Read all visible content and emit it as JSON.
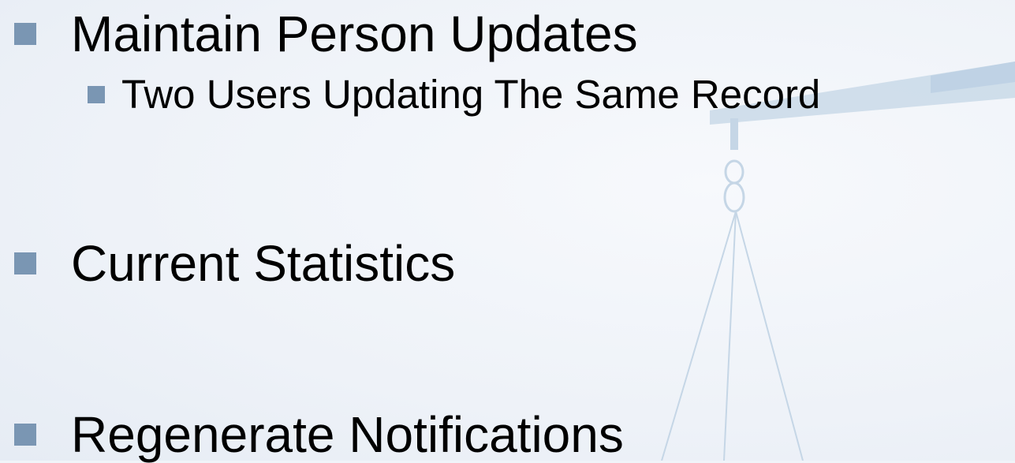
{
  "slide": {
    "bullets": [
      {
        "text": "Maintain Person Updates",
        "sub_bullets": [
          {
            "text": "Two Users Updating The Same Record"
          }
        ]
      },
      {
        "text": "Current Statistics"
      },
      {
        "text": "Regenerate Notifications"
      }
    ]
  },
  "colors": {
    "bullet": "#7a96b3",
    "text": "#000000",
    "decor": "#c5d6e6"
  },
  "icons": {
    "background_graphic": "balance-scale-icon"
  }
}
